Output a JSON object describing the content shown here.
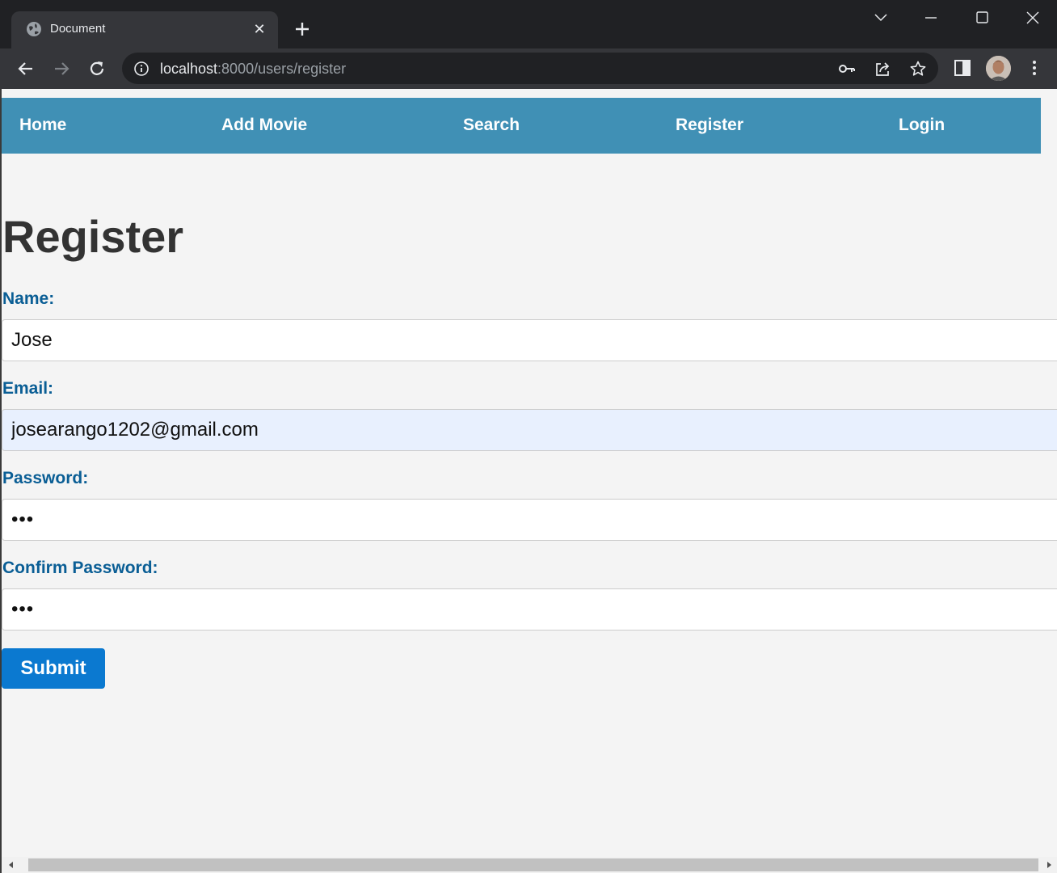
{
  "browser": {
    "tab_title": "Document",
    "tab_close_glyph": "✕",
    "url_host": "localhost",
    "url_rest": ":8000/users/register",
    "icons": [
      "globe-icon",
      "new-tab-icon",
      "tab-list-icon",
      "minimize-icon",
      "maximize-icon",
      "window-close-icon",
      "back-icon",
      "forward-icon",
      "reload-icon",
      "site-info-icon",
      "password-key-icon",
      "share-icon",
      "bookmark-star-icon",
      "side-panel-icon",
      "profile-avatar",
      "menu-icon"
    ]
  },
  "navbar": {
    "items": [
      {
        "label": "Home"
      },
      {
        "label": "Add Movie"
      },
      {
        "label": "Search"
      },
      {
        "label": "Register"
      },
      {
        "label": "Login"
      }
    ],
    "background": "#4090b5"
  },
  "page": {
    "title": "Register",
    "fields": [
      {
        "label": "Name:",
        "value": "Jose",
        "type": "text"
      },
      {
        "label": "Email:",
        "value": "josearango1202@gmail.com",
        "type": "email"
      },
      {
        "label": "Password:",
        "value": "•••",
        "type": "password"
      },
      {
        "label": "Confirm Password:",
        "value": "•••",
        "type": "password"
      }
    ],
    "submit_label": "Submit",
    "label_color": "#0a5e95",
    "button_color": "#0b79d0"
  }
}
